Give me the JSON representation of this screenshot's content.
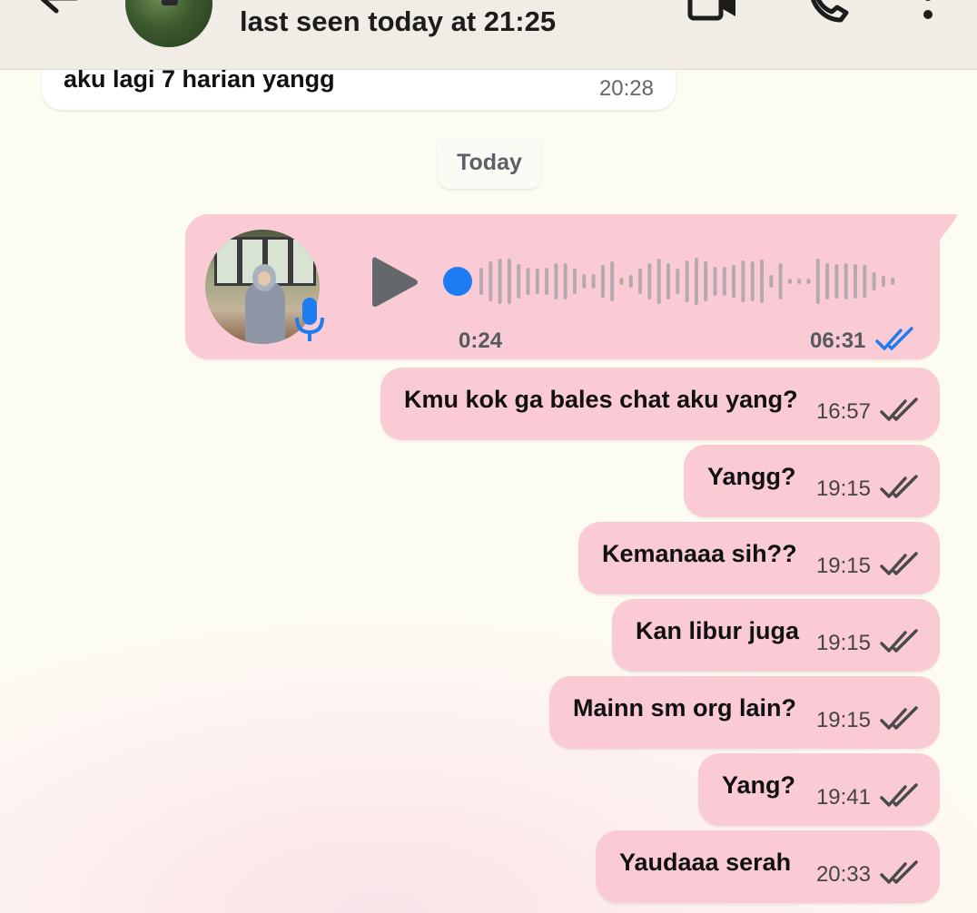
{
  "header": {
    "status": "last seen today at 21:25",
    "icons": [
      "back-arrow-icon",
      "contact-avatar",
      "video-call-icon",
      "voice-call-icon",
      "more-options-icon"
    ]
  },
  "incoming_message": {
    "text": "aku lagi 7 harian yangg",
    "time": "20:28"
  },
  "date_chip": "Today",
  "voice_message": {
    "elapsed": "0:24",
    "time": "06:31",
    "status": "read",
    "progress": 0.02
  },
  "outgoing_messages": [
    {
      "text": "Kmu kok ga bales chat aku yang?",
      "time": "16:57",
      "status": "delivered"
    },
    {
      "text": "Yangg?",
      "time": "19:15",
      "status": "delivered"
    },
    {
      "text": "Kemanaaa sih??",
      "time": "19:15",
      "status": "delivered"
    },
    {
      "text": "Kan libur juga",
      "time": "19:15",
      "status": "delivered"
    },
    {
      "text": "Mainn sm org lain?",
      "time": "19:15",
      "status": "delivered"
    },
    {
      "text": "Yang?",
      "time": "19:41",
      "status": "delivered"
    },
    {
      "text": "Yaudaaa serah",
      "time": "20:33",
      "status": "delivered"
    }
  ],
  "colors": {
    "header_bg": "#f1ede6",
    "chat_bg": "#fdfcf3",
    "outgoing_bubble": "#fbcbd5",
    "incoming_bubble": "#ffffff",
    "read_tick": "#1d7cf2",
    "delivered_tick": "#4a4a4a",
    "accent_blue": "#1d7cf2"
  }
}
